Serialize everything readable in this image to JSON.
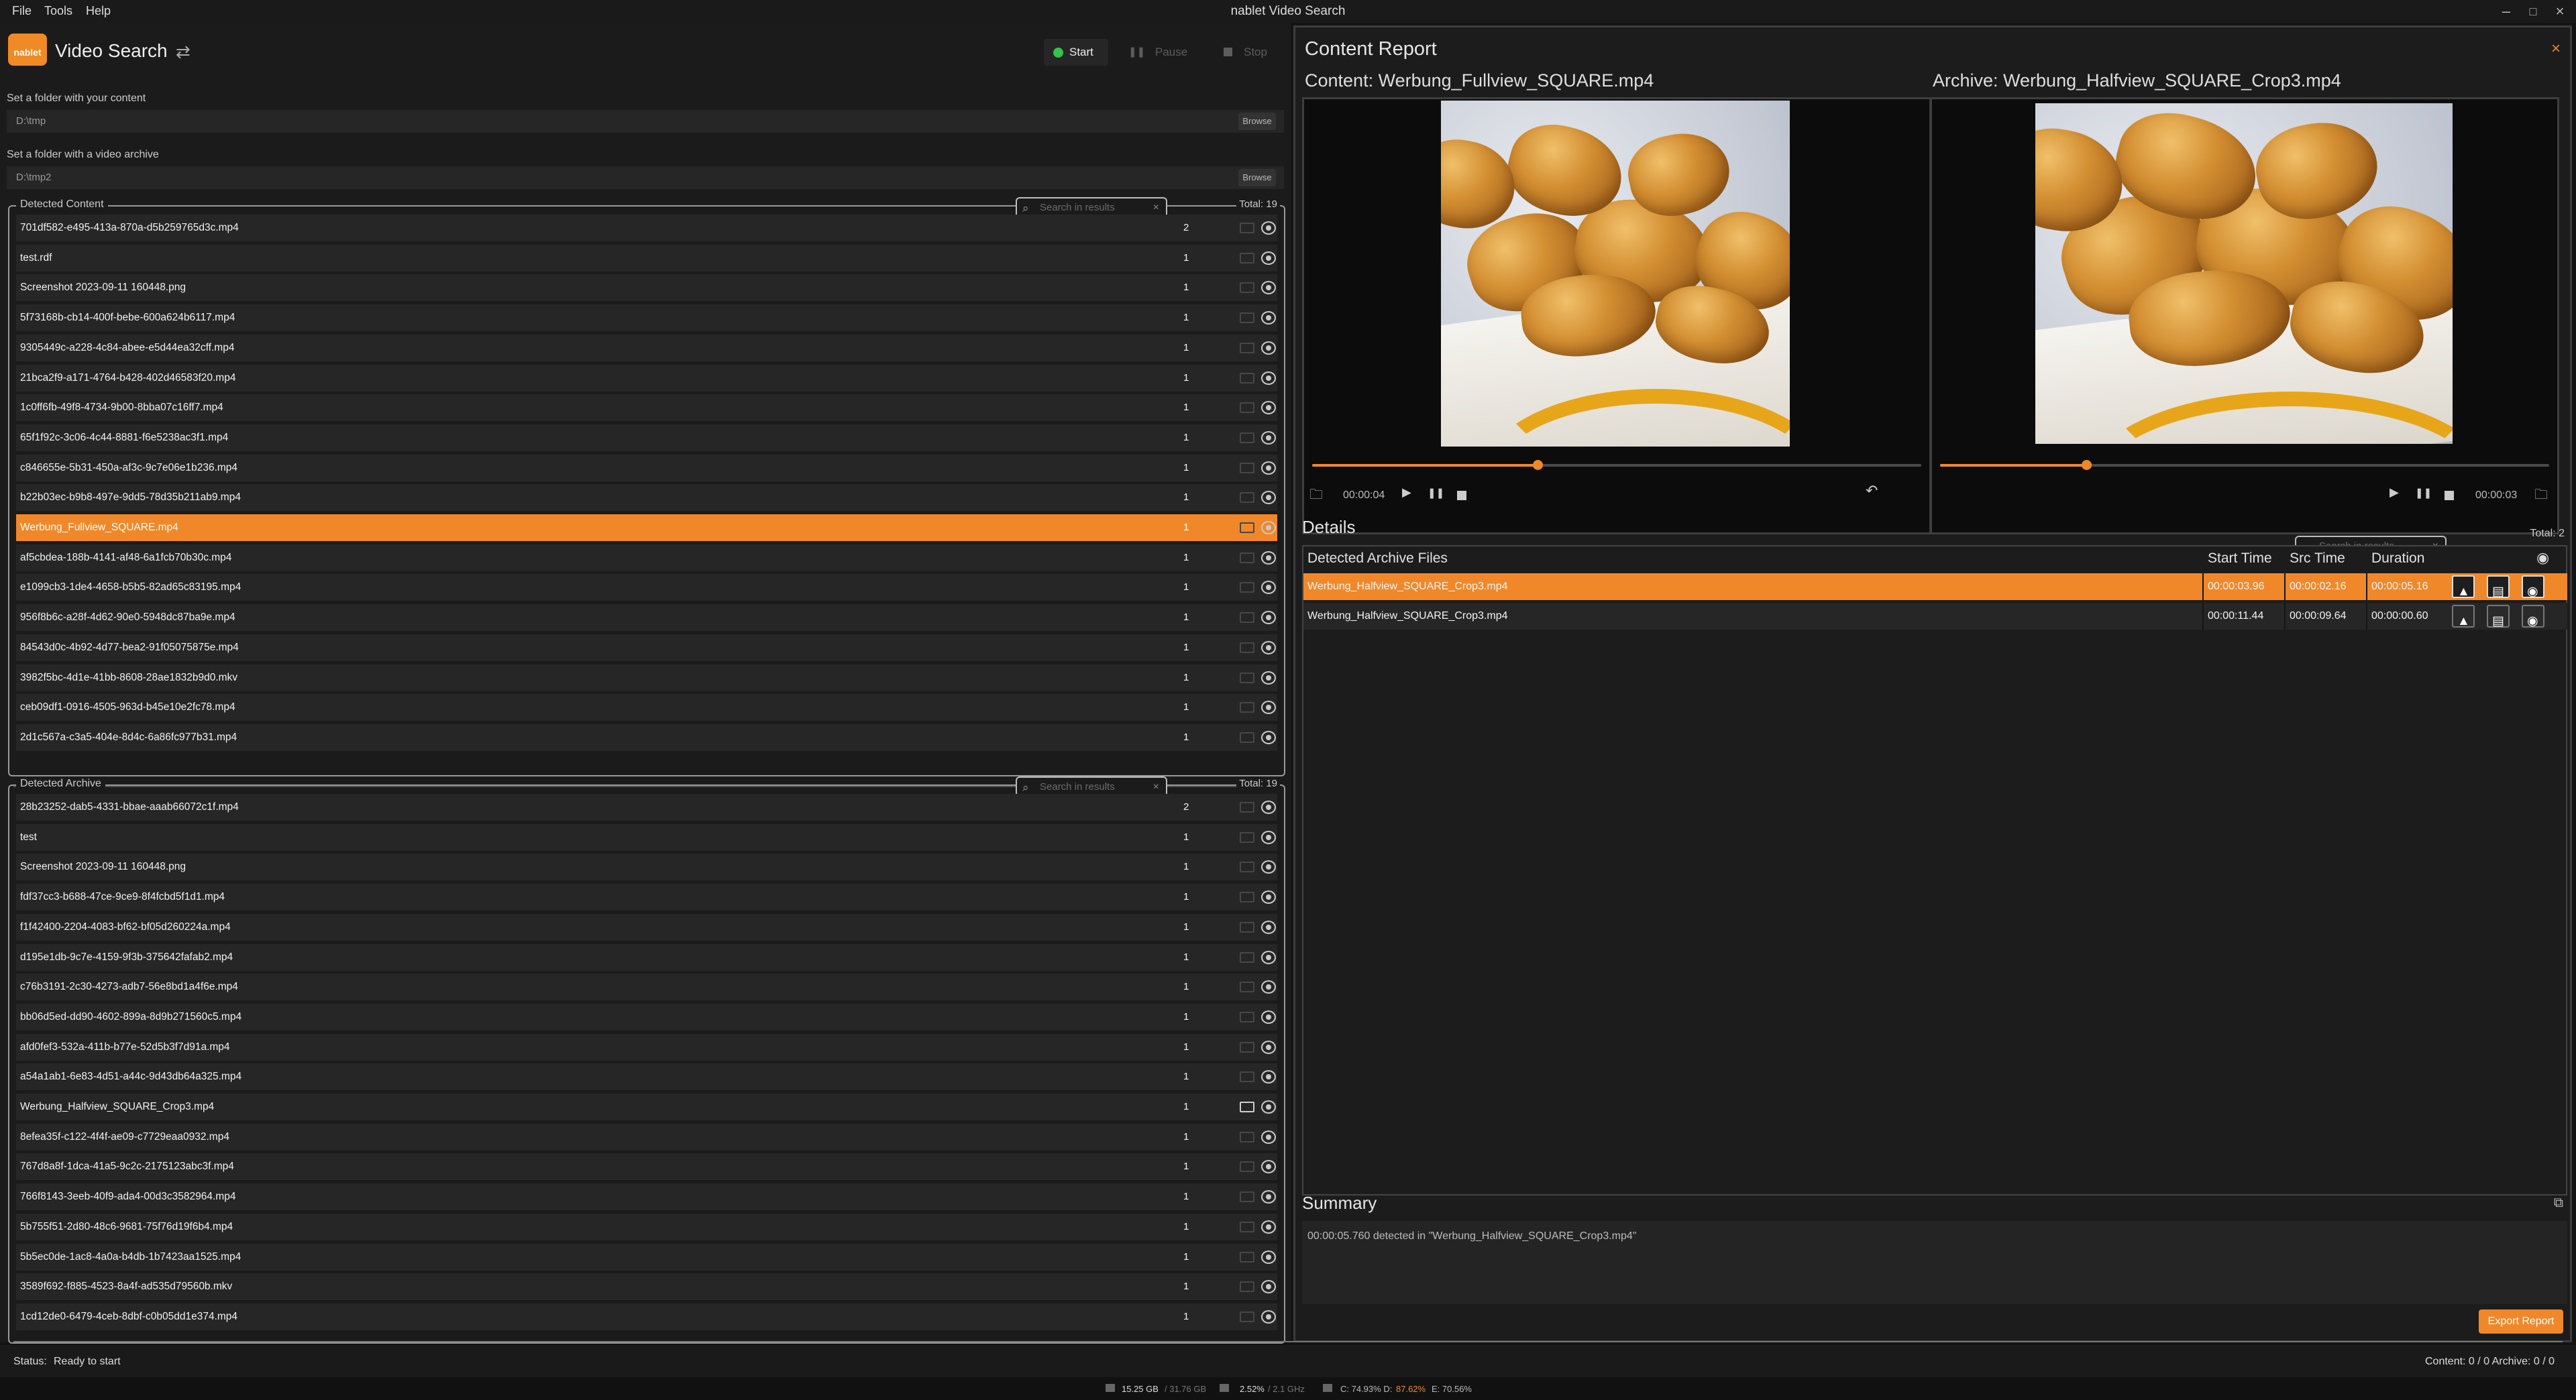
{
  "window": {
    "title": "nablet Video Search"
  },
  "menu": [
    "File",
    "Tools",
    "Help"
  ],
  "app": {
    "logo_text": "nablet",
    "title": "Video Search"
  },
  "toolbar": {
    "start": "Start",
    "pause": "Pause",
    "stop": "Stop"
  },
  "content_folder": {
    "label": "Set a folder with your content",
    "value": "D:\\tmp",
    "browse": "Browse"
  },
  "archive_folder": {
    "label": "Set a folder with a video archive",
    "value": "D:\\tmp2",
    "browse": "Browse"
  },
  "detected_content": {
    "title": "Detected Content",
    "search_placeholder": "Search in results",
    "total": "Total: 19",
    "rows": [
      {
        "name": "701df582-e495-413a-870a-d5b259765d3c.mp4",
        "count": "2"
      },
      {
        "name": "test.rdf",
        "count": "1"
      },
      {
        "name": "Screenshot 2023-09-11 160448.png",
        "count": "1"
      },
      {
        "name": "5f73168b-cb14-400f-bebe-600a624b6117.mp4",
        "count": "1"
      },
      {
        "name": "9305449c-a228-4c84-abee-e5d44ea32cff.mp4",
        "count": "1"
      },
      {
        "name": "21bca2f9-a171-4764-b428-402d46583f20.mp4",
        "count": "1"
      },
      {
        "name": "1c0ff6fb-49f8-4734-9b00-8bba07c16ff7.mp4",
        "count": "1"
      },
      {
        "name": "65f1f92c-3c06-4c44-8881-f6e5238ac3f1.mp4",
        "count": "1"
      },
      {
        "name": "c846655e-5b31-450a-af3c-9c7e06e1b236.mp4",
        "count": "1"
      },
      {
        "name": "b22b03ec-b9b8-497e-9dd5-78d35b211ab9.mp4",
        "count": "1"
      },
      {
        "name": "Werbung_Fullview_SQUARE.mp4",
        "count": "1"
      },
      {
        "name": "af5cbdea-188b-4141-af48-6a1fcb70b30c.mp4",
        "count": "1"
      },
      {
        "name": "e1099cb3-1de4-4658-b5b5-82ad65c83195.mp4",
        "count": "1"
      },
      {
        "name": "956f8b6c-a28f-4d62-90e0-5948dc87ba9e.mp4",
        "count": "1"
      },
      {
        "name": "84543d0c-4b92-4d77-bea2-91f05075875e.mp4",
        "count": "1"
      },
      {
        "name": "3982f5bc-4d1e-41bb-8608-28ae1832b9d0.mkv",
        "count": "1"
      },
      {
        "name": "ceb09df1-0916-4505-963d-b45e10e2fc78.mp4",
        "count": "1"
      },
      {
        "name": "2d1c567a-c3a5-404e-8d4c-6a86fc977b31.mp4",
        "count": "1"
      }
    ]
  },
  "detected_archive": {
    "title": "Detected Archive",
    "search_placeholder": "Search in results",
    "total": "Total: 19",
    "rows": [
      {
        "name": "28b23252-dab5-4331-bbae-aaab66072c1f.mp4",
        "count": "2"
      },
      {
        "name": "test",
        "count": "1"
      },
      {
        "name": "Screenshot 2023-09-11 160448.png",
        "count": "1"
      },
      {
        "name": "fdf37cc3-b688-47ce-9ce9-8f4fcbd5f1d1.mp4",
        "count": "1"
      },
      {
        "name": "f1f42400-2204-4083-bf62-bf05d260224a.mp4",
        "count": "1"
      },
      {
        "name": "d195e1db-9c7e-4159-9f3b-375642fafab2.mp4",
        "count": "1"
      },
      {
        "name": "c76b3191-2c30-4273-adb7-56e8bd1a4f6e.mp4",
        "count": "1"
      },
      {
        "name": "bb06d5ed-dd90-4602-899a-8d9b271560c5.mp4",
        "count": "1"
      },
      {
        "name": "afd0fef3-532a-411b-b77e-52d5b3f7d91a.mp4",
        "count": "1"
      },
      {
        "name": "a54a1ab1-6e83-4d51-a44c-9d43db64a325.mp4",
        "count": "1"
      },
      {
        "name": "Werbung_Halfview_SQUARE_Crop3.mp4",
        "count": "1"
      },
      {
        "name": "8efea35f-c122-4f4f-ae09-c7729eaa0932.mp4",
        "count": "1"
      },
      {
        "name": "767d8a8f-1dca-41a5-9c2c-2175123abc3f.mp4",
        "count": "1"
      },
      {
        "name": "766f8143-3eeb-40f9-ada4-00d3c3582964.mp4",
        "count": "1"
      },
      {
        "name": "5b755f51-2d80-48c6-9681-75f76d19f6b4.mp4",
        "count": "1"
      },
      {
        "name": "5b5ec0de-1ac8-4a0a-b4db-1b7423aa1525.mp4",
        "count": "1"
      },
      {
        "name": "3589f692-f885-4523-8a4f-ad535d79560b.mkv",
        "count": "1"
      },
      {
        "name": "1cd12de0-6479-4ceb-8dbf-c0b05dd1e374.mp4",
        "count": "1"
      }
    ]
  },
  "status": {
    "label": "Status:",
    "value": "Ready to start",
    "counts": "Content: 0 / 0  Archive: 0 / 0"
  },
  "sysbar": {
    "mem": "15.25 GB",
    "mem_total": "/ 31.76 GB",
    "cpu": "2.52%",
    "cpu_freq": "/ 2.1 GHz",
    "disks_prefix": "C: 74.93%  D:",
    "disk_d": "87.62%",
    "disk_e": "E: 70.56%",
    "accent": "#f0882a"
  },
  "report": {
    "title": "Content Report",
    "content_label": "Content:  Werbung_Fullview_SQUARE.mp4",
    "archive_label": "Archive:  Werbung_Halfview_SQUARE_Crop3.mp4",
    "content_time": "00:00:04",
    "archive_time": "00:00:03",
    "content_progress": 0.37,
    "archive_progress": 0.24
  },
  "details": {
    "title": "Details",
    "search_placeholder": "Search in results",
    "total": "Total:  2",
    "columns": [
      "Detected Archive Files",
      "Start Time",
      "Src Time",
      "Duration"
    ],
    "rows": [
      {
        "file": "Werbung_Halfview_SQUARE_Crop3.mp4",
        "start": "00:00:03.96",
        "src": "00:00:02.16",
        "dur": "00:00:05.16"
      },
      {
        "file": "Werbung_Halfview_SQUARE_Crop3.mp4",
        "start": "00:00:11.44",
        "src": "00:00:09.64",
        "dur": "00:00:00.60"
      }
    ]
  },
  "summary": {
    "title": "Summary",
    "text": "00:00:05.760 detected in \"Werbung_Halfview_SQUARE_Crop3.mp4\"",
    "export": "Export Report"
  }
}
